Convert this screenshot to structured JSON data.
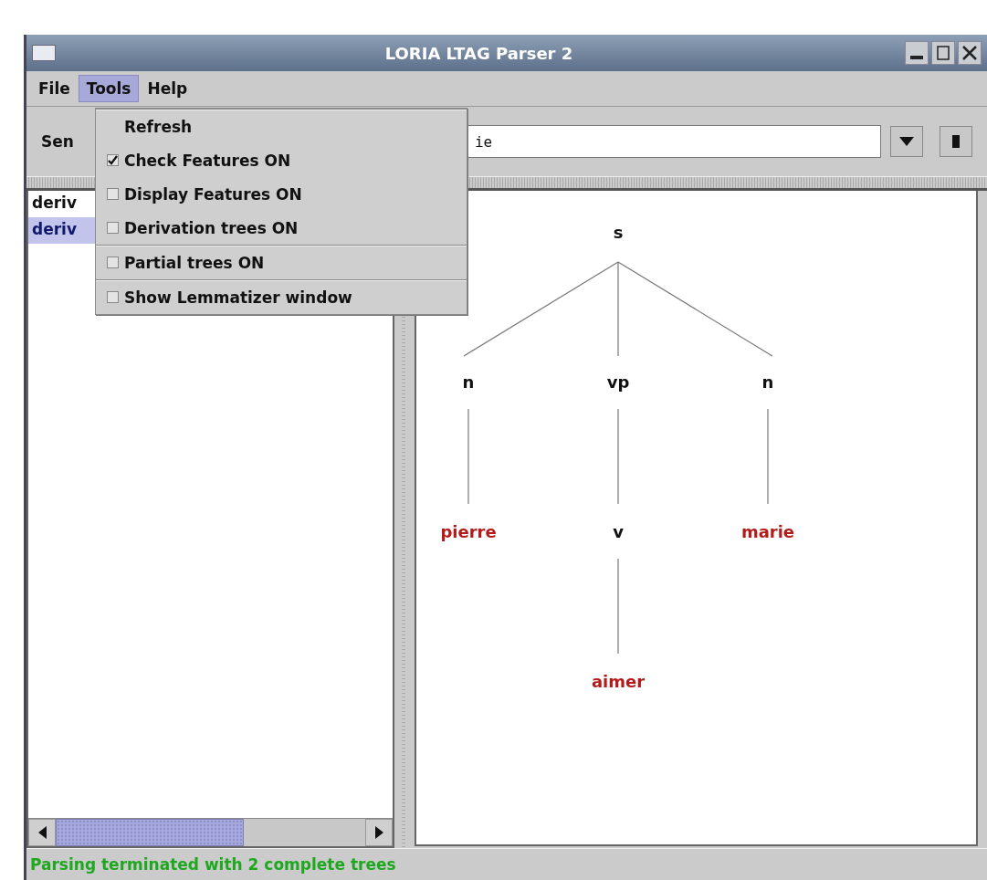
{
  "window": {
    "title": "LORIA LTAG Parser 2"
  },
  "menu_bar": [
    {
      "label": "File",
      "selected": false
    },
    {
      "label": "Tools",
      "selected": true
    },
    {
      "label": "Help",
      "selected": false
    }
  ],
  "tools_menu": {
    "groups": [
      [
        {
          "kind": "action",
          "label": "Refresh"
        },
        {
          "kind": "checkbox",
          "label": "Check Features ON",
          "checked": true
        },
        {
          "kind": "checkbox",
          "label": "Display Features ON",
          "checked": false
        },
        {
          "kind": "checkbox",
          "label": "Derivation trees ON",
          "checked": false
        }
      ],
      [
        {
          "kind": "checkbox",
          "label": "Partial trees ON",
          "checked": false
        }
      ],
      [
        {
          "kind": "checkbox",
          "label": "Show Lemmatizer window",
          "checked": false
        }
      ]
    ]
  },
  "sentence": {
    "label": "Sen",
    "value": "ie"
  },
  "derivations": [
    {
      "label": "deriv",
      "selected": false
    },
    {
      "label": "deriv",
      "selected": true
    }
  ],
  "tree": {
    "label": "s",
    "kind": "category",
    "children": [
      {
        "label": "n",
        "kind": "category",
        "children": [
          {
            "label": "pierre",
            "kind": "lexical"
          }
        ]
      },
      {
        "label": "vp",
        "kind": "category",
        "children": [
          {
            "label": "v",
            "kind": "category",
            "children": [
              {
                "label": "aimer",
                "kind": "lexical"
              }
            ]
          }
        ]
      },
      {
        "label": "n",
        "kind": "category",
        "children": [
          {
            "label": "marie",
            "kind": "lexical"
          }
        ]
      }
    ]
  },
  "status_bar": "Parsing terminated with 2 complete trees"
}
